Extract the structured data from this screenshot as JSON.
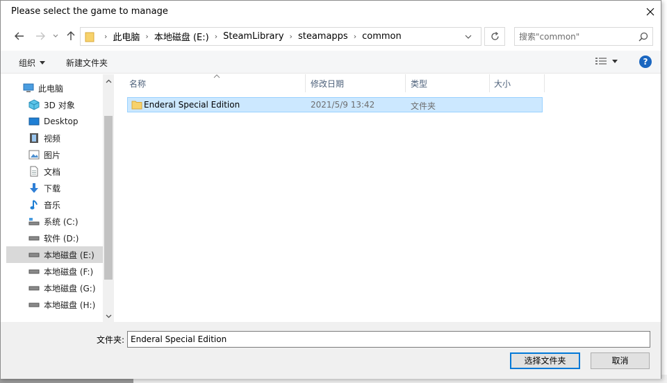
{
  "window": {
    "title": "Please select the game to manage"
  },
  "nav": {
    "breadcrumbs": [
      "此电脑",
      "本地磁盘 (E:)",
      "SteamLibrary",
      "steamapps",
      "common"
    ]
  },
  "search": {
    "placeholder": "搜索\"common\""
  },
  "toolbar": {
    "organize_label": "组织",
    "new_folder_label": "新建文件夹"
  },
  "sidebar": {
    "items": [
      {
        "label": "此电脑",
        "icon": "computer-icon"
      },
      {
        "label": "3D 对象",
        "icon": "cube-icon"
      },
      {
        "label": "Desktop",
        "icon": "desktop-icon"
      },
      {
        "label": "视频",
        "icon": "video-icon"
      },
      {
        "label": "图片",
        "icon": "pictures-icon"
      },
      {
        "label": "文档",
        "icon": "document-icon"
      },
      {
        "label": "下载",
        "icon": "download-icon"
      },
      {
        "label": "音乐",
        "icon": "music-icon"
      },
      {
        "label": "系统 (C:)",
        "icon": "system-drive-icon"
      },
      {
        "label": "软件 (D:)",
        "icon": "drive-icon"
      },
      {
        "label": "本地磁盘 (E:)",
        "icon": "drive-icon",
        "selected": true
      },
      {
        "label": "本地磁盘 (F:)",
        "icon": "drive-icon"
      },
      {
        "label": "本地磁盘 (G:)",
        "icon": "drive-icon"
      },
      {
        "label": "本地磁盘 (H:)",
        "icon": "drive-icon"
      }
    ]
  },
  "columns": [
    "名称",
    "修改日期",
    "类型",
    "大小"
  ],
  "files": [
    {
      "name": "Enderal Special Edition",
      "modified": "2021/5/9 13:42",
      "type": "文件夹",
      "size": ""
    }
  ],
  "footer": {
    "folder_label": "文件夹:",
    "folder_value": "Enderal Special Edition",
    "select_button": "选择文件夹",
    "cancel_button": "取消"
  },
  "colors": {
    "accent": "#0078d7",
    "selection": "#cce8ff",
    "folder": "#f7d26b",
    "help": "#1a66c0"
  }
}
